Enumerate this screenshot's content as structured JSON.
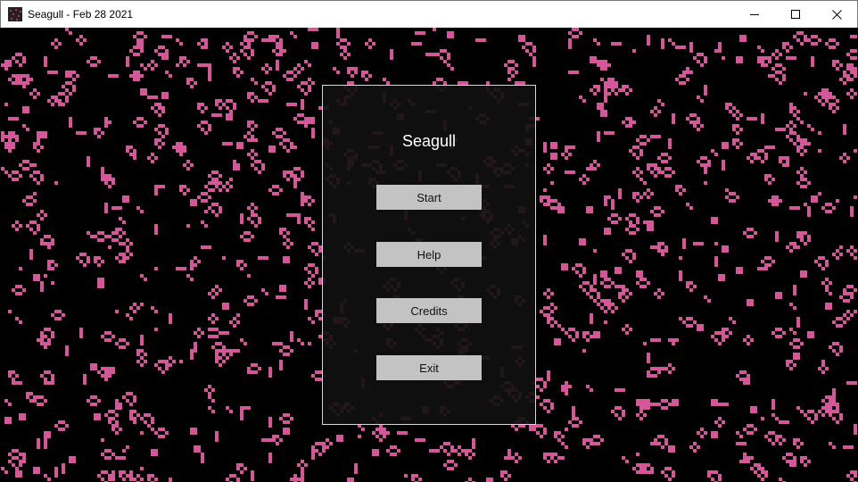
{
  "window": {
    "title": "Seagull - Feb 28 2021",
    "controls": {
      "minimize_icon": "minimize-icon",
      "maximize_icon": "maximize-icon",
      "close_icon": "close-icon"
    }
  },
  "background": {
    "cell_color": "#d4579a",
    "bg_color": "#000000"
  },
  "menu": {
    "title": "Seagull",
    "buttons": {
      "start": "Start",
      "help": "Help",
      "credits": "Credits",
      "exit": "Exit"
    }
  }
}
